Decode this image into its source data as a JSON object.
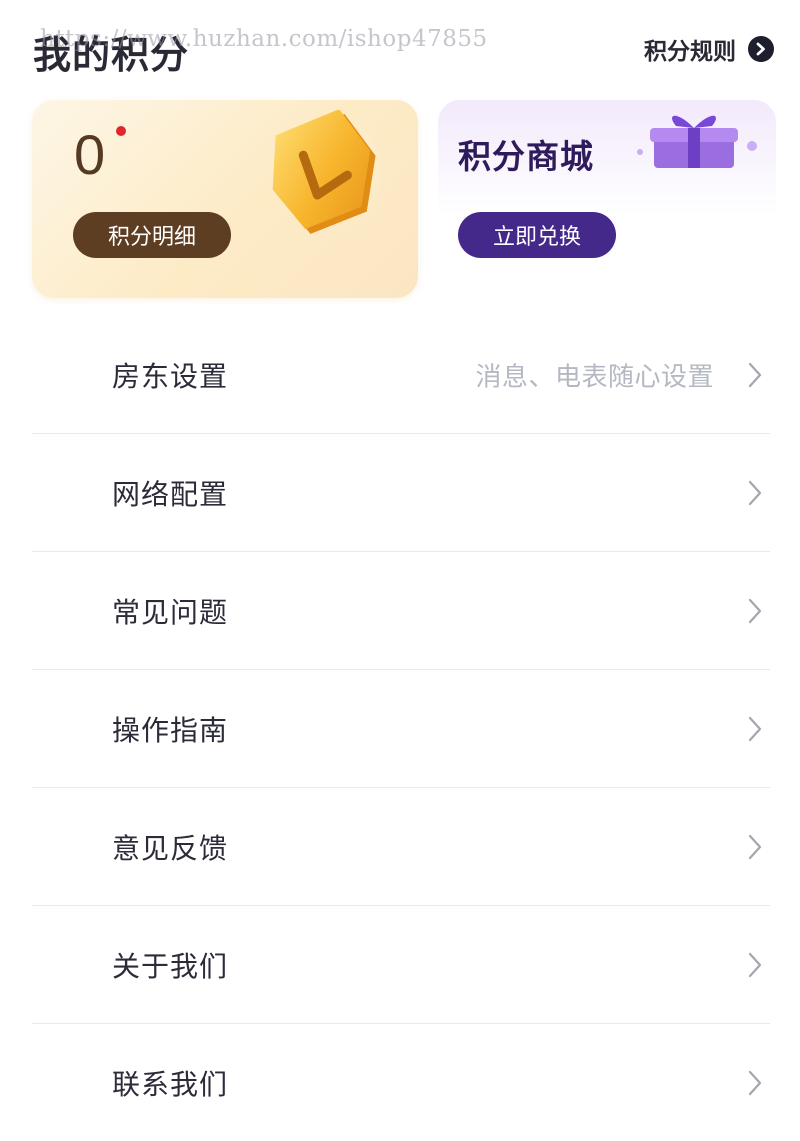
{
  "header": {
    "title": "我的积分",
    "watermark": "https://www.huzhan.com/ishop47855",
    "rules_label": "积分规则"
  },
  "points_card": {
    "value": "0",
    "detail_button": "积分明细"
  },
  "mall_card": {
    "title": "积分商城",
    "redeem_button": "立即兑换"
  },
  "menu": {
    "items": [
      {
        "label": "房东设置",
        "hint": "消息、电表随心设置"
      },
      {
        "label": "网络配置",
        "hint": ""
      },
      {
        "label": "常见问题",
        "hint": ""
      },
      {
        "label": "操作指南",
        "hint": ""
      },
      {
        "label": "意见反馈",
        "hint": ""
      },
      {
        "label": "关于我们",
        "hint": ""
      },
      {
        "label": "联系我们",
        "hint": ""
      }
    ]
  },
  "colors": {
    "points_accent": "#5e3e22",
    "mall_accent": "#44288a",
    "notification_dot": "#e3262b",
    "hint_text": "#b4b8c2"
  },
  "icons": [
    "arrow-circle-right-icon",
    "coin-icon",
    "gift-box-icon",
    "chevron-right-icon"
  ]
}
